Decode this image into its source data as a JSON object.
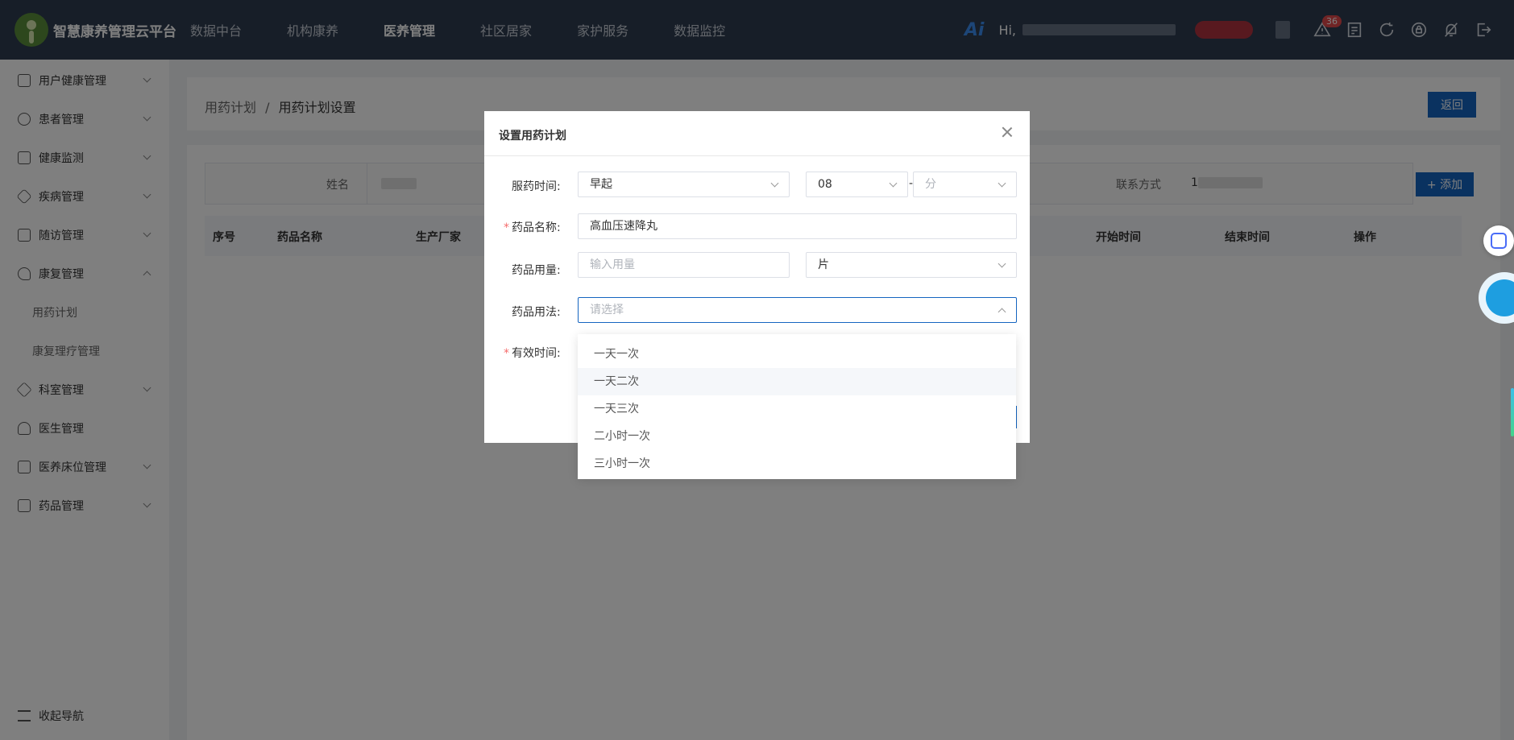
{
  "header": {
    "app_title": "智慧康养管理云平台",
    "nav": [
      "数据中台",
      "机构康养",
      "医养管理",
      "社区居家",
      "家护服务",
      "数据监控"
    ],
    "active_nav": "医养管理",
    "ai_label": "Ai",
    "greeting": "Hi,",
    "alert_count": "36",
    "icons": [
      "warning-icon",
      "report-icon",
      "refresh-icon",
      "lock-icon",
      "bell-off-icon",
      "logout-icon"
    ]
  },
  "sidebar": {
    "items": [
      {
        "label": "用户健康管理",
        "icon": "user-health-icon"
      },
      {
        "label": "患者管理",
        "icon": "wheelchair-icon"
      },
      {
        "label": "健康监测",
        "icon": "monitor-icon"
      },
      {
        "label": "疾病管理",
        "icon": "disease-icon"
      },
      {
        "label": "随访管理",
        "icon": "followup-icon"
      },
      {
        "label": "康复管理",
        "icon": "heart-icon"
      }
    ],
    "sub_items": [
      "用药计划",
      "康复理疗管理"
    ],
    "items_after": [
      {
        "label": "科室管理",
        "icon": "department-icon"
      },
      {
        "label": "医生管理",
        "icon": "doctor-icon"
      },
      {
        "label": "医养床位管理",
        "icon": "bed-icon"
      },
      {
        "label": "药品管理",
        "icon": "medicine-icon"
      }
    ],
    "collapse_label": "收起导航"
  },
  "page": {
    "breadcrumb_parent": "用药计划",
    "breadcrumb_sep": "/",
    "breadcrumb_current": "用药计划设置",
    "back_button": "返回",
    "add_button": "+ 添加",
    "filter_name_label": "姓名",
    "filter_contact_label": "联系方式",
    "filter_contact_value": "1",
    "table_headers": [
      "序号",
      "药品名称",
      "生产厂家",
      "开始时间",
      "结束时间",
      "操作"
    ]
  },
  "modal": {
    "title": "设置用药计划",
    "time_label": "服药时间:",
    "time_period": "早起",
    "time_hour": "08",
    "time_sep": "-",
    "time_minute_placeholder": "分",
    "drug_name_label": "药品名称:",
    "drug_name_value": "高血压速降丸",
    "dosage_label": "药品用量:",
    "dosage_placeholder": "输入用量",
    "dosage_unit": "片",
    "usage_label": "药品用法:",
    "usage_placeholder": "请选择",
    "valid_label": "有效时间:"
  },
  "usage_dropdown": {
    "options": [
      "一天一次",
      "一天二次",
      "一天三次",
      "二小时一次",
      "三小时一次"
    ],
    "hovered": "一天二次"
  }
}
